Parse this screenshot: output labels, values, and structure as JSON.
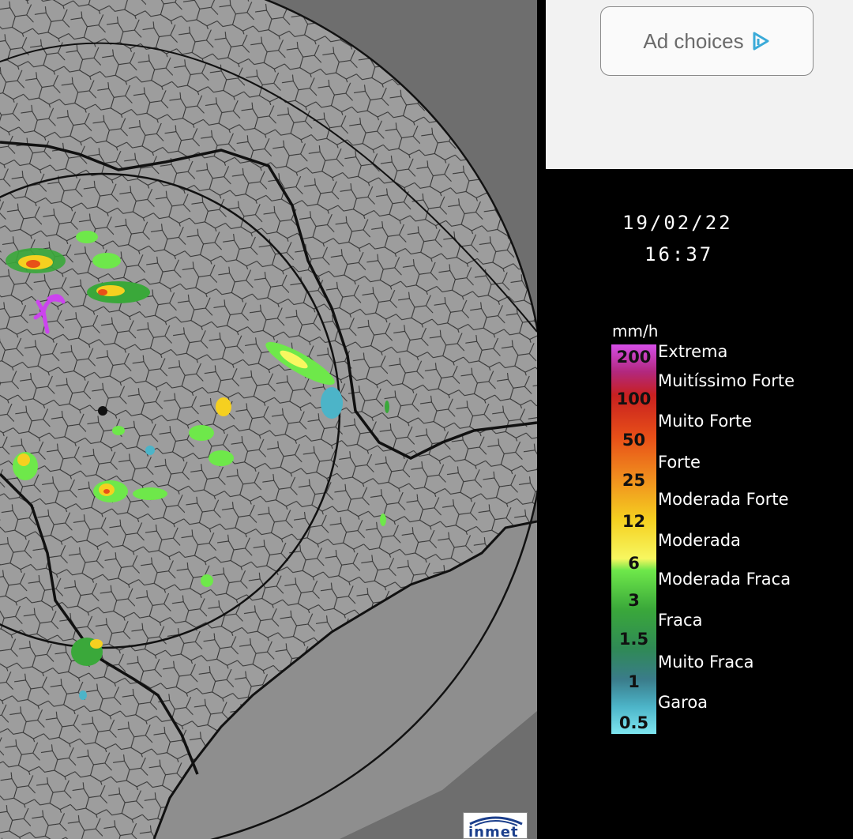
{
  "ad": {
    "label": "Ad choices",
    "icon": "adchoices-icon"
  },
  "timestamp": {
    "date": "19/02/22",
    "time": "16:37"
  },
  "legend": {
    "unit": "mm/h",
    "ticks": [
      "200",
      "100",
      "50",
      "25",
      "12",
      "6",
      "3",
      "1.5",
      "1",
      "0.5"
    ],
    "categories": [
      "Extrema",
      "Muitíssimo Forte",
      "Muito Forte",
      "Forte",
      "Moderada Forte",
      "Moderada",
      "Moderada Fraca",
      "Fraca",
      "Muito Fraca",
      "Garoa"
    ],
    "colors": [
      "#d64ee8",
      "#c0328f",
      "#c82020",
      "#e85018",
      "#f08c1e",
      "#f5d020",
      "#f7f760",
      "#6ee84a",
      "#3aa83a",
      "#2f8a55",
      "#3a7c8a",
      "#4cb4c8",
      "#7ee6f0"
    ]
  },
  "logo": {
    "text": "inmet"
  },
  "colors": {
    "land": "#9d9d9d",
    "sea": "#6e6e6e",
    "borders": "#111111",
    "marker": "#cc44ee"
  }
}
